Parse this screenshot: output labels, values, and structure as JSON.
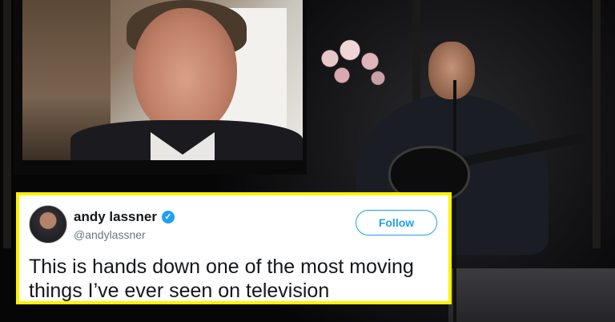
{
  "tweet": {
    "name": "andy lassner",
    "handle": "@andylassner",
    "follow_label": "Follow",
    "text_line1": "This is hands down one of the most moving",
    "text_line2": "things I’ve ever seen on television"
  },
  "colors": {
    "highlight_border": "#fff200",
    "twitter_blue": "#1da1f2"
  },
  "icons": {
    "verified": "verified-badge-icon"
  }
}
